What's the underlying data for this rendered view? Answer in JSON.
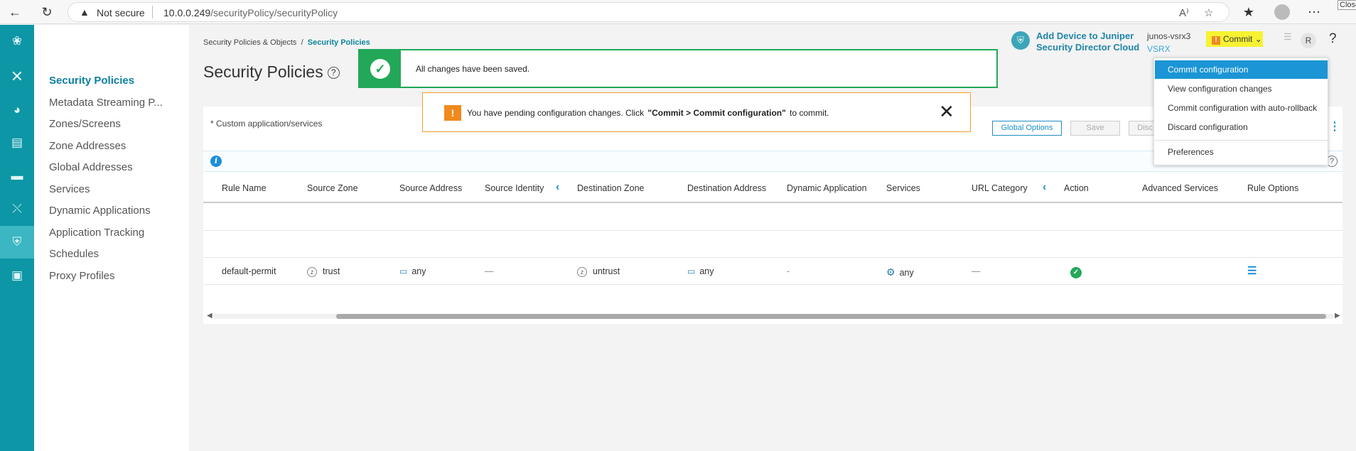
{
  "browser": {
    "not_secure": "Not secure",
    "url_host": "10.0.0.249",
    "url_path": "/securityPolicy/securityPolicy",
    "close_tooltip": "Close"
  },
  "breadcrumb": {
    "parent": "Security Policies & Objects",
    "separator": "/",
    "current": "Security Policies"
  },
  "page_title": "Security Policies",
  "help_symbol": "?",
  "leftnav": {
    "items": [
      "Security Policies",
      "Metadata Streaming P...",
      "Zones/Screens",
      "Zone Addresses",
      "Global Addresses",
      "Services",
      "Dynamic Applications",
      "Application Tracking",
      "Schedules",
      "Proxy Profiles"
    ]
  },
  "toast_success": {
    "message": "All changes have been saved."
  },
  "toast_warning": {
    "prefix": "You have pending configuration changes. Click",
    "bold": "\"Commit > Commit configuration\"",
    "suffix": "to commit."
  },
  "header": {
    "brand_line1": "Add Device to Juniper",
    "brand_line2": "Security Director Cloud",
    "device_name": "junos-vsrx3",
    "device_type": "VSRX",
    "commit_label": "Commit",
    "avatar_initial": "R",
    "help": "?"
  },
  "commit_menu": {
    "items": [
      "Commit configuration",
      "View configuration changes",
      "Commit configuration with auto-rollback",
      "Discard configuration",
      "Preferences"
    ],
    "selected_index": 0
  },
  "panel": {
    "custom_note": "* Custom application/services",
    "global_options": "Global Options",
    "save": "Save",
    "discard": "Disc"
  },
  "table": {
    "columns": [
      "Rule Name",
      "Source Zone",
      "Source Address",
      "Source Identity",
      "Destination Zone",
      "Destination Address",
      "Dynamic Application",
      "Services",
      "URL Category",
      "Action",
      "Advanced Services",
      "Rule Options"
    ],
    "rows": [
      {
        "rule_name": "default-permit",
        "source_zone": "trust",
        "source_address": "any",
        "source_identity": "—",
        "destination_zone": "untrust",
        "destination_address": "any",
        "dynamic_application": "-",
        "services": "any",
        "url_category": "—"
      }
    ]
  },
  "colors": {
    "rail": "#0d96a5",
    "success": "#22a858",
    "warning": "#f59c28",
    "accent": "#1b95d5",
    "commit_highlight": "#f7f232"
  }
}
